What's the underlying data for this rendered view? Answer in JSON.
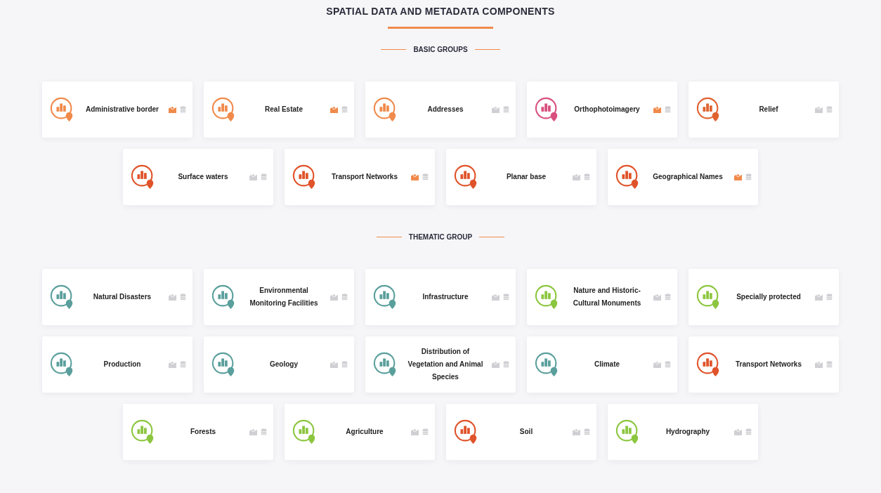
{
  "title": "SPATIAL DATA AND METADATA COMPONENTS",
  "sections": [
    {
      "title": "BASIC GROUPS",
      "rows": [
        [
          {
            "label": "Administrative border",
            "color": "#f08a4b",
            "map_available": true
          },
          {
            "label": "Real Estate",
            "color": "#f08a4b",
            "map_available": true
          },
          {
            "label": "Addresses",
            "color": "#f08a4b",
            "map_available": false
          },
          {
            "label": "Orthophotoimagery",
            "color": "#d9507e",
            "map_available": true
          },
          {
            "label": "Relief",
            "color": "#e0622f",
            "map_available": false
          }
        ],
        [
          {
            "label": "Surface waters",
            "color": "#e0532a",
            "map_available": false
          },
          {
            "label": "Transport Networks",
            "color": "#e0532a",
            "map_available": true
          },
          {
            "label": "Planar base",
            "color": "#e0532a",
            "map_available": false
          },
          {
            "label": "Geographical Names",
            "color": "#e0532a",
            "map_available": true
          }
        ]
      ]
    },
    {
      "title": "THEMATIC GROUP",
      "rows": [
        [
          {
            "label": "Natural Disasters",
            "color": "#5a9f9c",
            "map_available": false
          },
          {
            "label": "Environmental Monitoring Facilities",
            "color": "#5a9f9c",
            "map_available": false
          },
          {
            "label": "Infrastructure",
            "color": "#5a9f9c",
            "map_available": false
          },
          {
            "label": "Nature and Historic-Cultural Monuments",
            "color": "#8cc63f",
            "map_available": false
          },
          {
            "label": "Specially protected",
            "color": "#8cc63f",
            "map_available": false
          }
        ],
        [
          {
            "label": "Production",
            "color": "#5a9f9c",
            "map_available": false
          },
          {
            "label": "Geology",
            "color": "#5a9f9c",
            "map_available": false
          },
          {
            "label": "Distribution of Vegetation and Animal Species",
            "color": "#5a9f9c",
            "map_available": false
          },
          {
            "label": "Climate",
            "color": "#5a9f9c",
            "map_available": false
          },
          {
            "label": "Transport Networks",
            "color": "#e0532a",
            "map_available": false
          }
        ],
        [
          {
            "label": "Forests",
            "color": "#8cc63f",
            "map_available": false
          },
          {
            "label": "Agriculture",
            "color": "#8cc63f",
            "map_available": false
          },
          {
            "label": "Soil",
            "color": "#e0532a",
            "map_available": false
          },
          {
            "label": "Hydrography",
            "color": "#8cc63f",
            "map_available": false
          }
        ]
      ]
    }
  ]
}
